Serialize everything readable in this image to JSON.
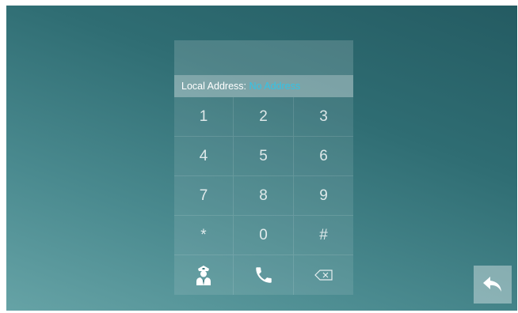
{
  "address": {
    "label": "Local Address:",
    "value": "No Address"
  },
  "display": {
    "value": ""
  },
  "keypad": {
    "keys": [
      "1",
      "2",
      "3",
      "4",
      "5",
      "6",
      "7",
      "8",
      "9",
      "*",
      "0",
      "#"
    ],
    "bottom_row_icons": [
      "guard-icon",
      "phone-icon",
      "backspace-icon"
    ]
  },
  "nav": {
    "back_icon": "back-arrow-icon"
  },
  "colors": {
    "accent": "#33c3e6",
    "background_top": "#245b62",
    "background_bottom": "#66a3a6"
  }
}
